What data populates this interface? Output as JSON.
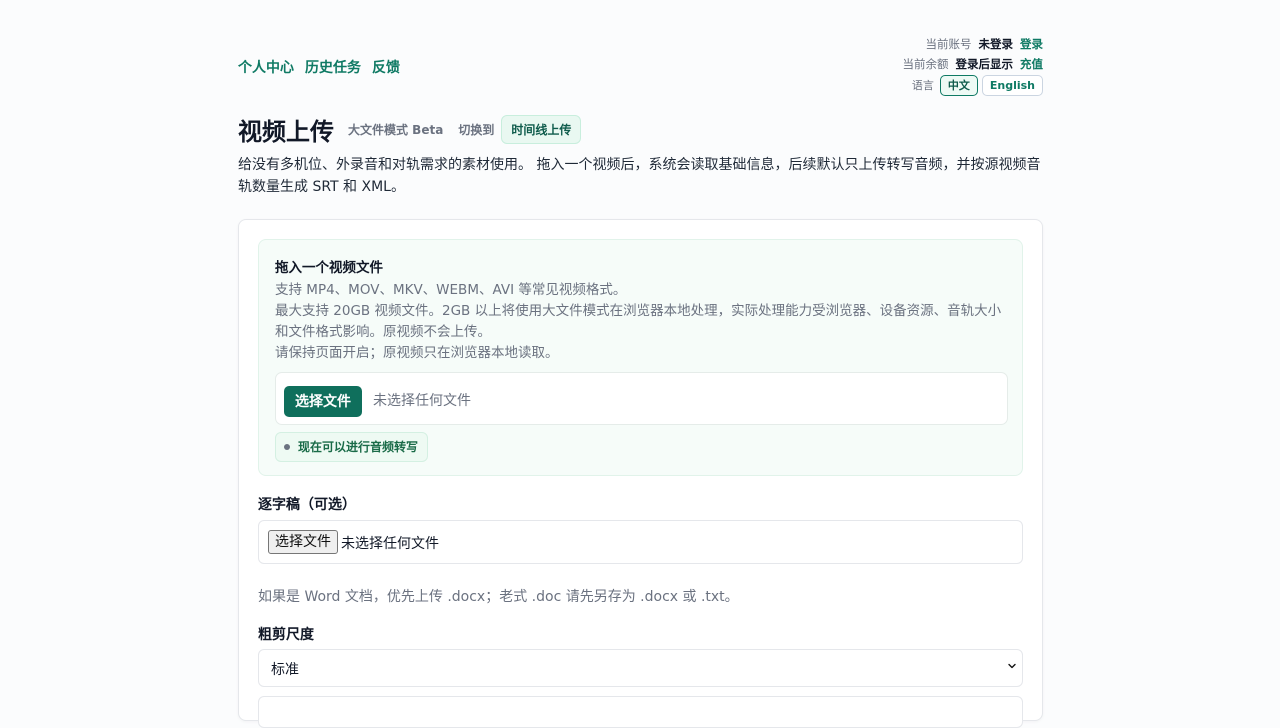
{
  "nav": {
    "items": [
      "个人中心",
      "历史任务",
      "反馈"
    ]
  },
  "account": {
    "account_label": "当前账号",
    "account_value": "未登录",
    "login_link": "登录",
    "balance_label": "当前余额",
    "balance_value": "登录后显示",
    "recharge_link": "充值",
    "language_label": "语言",
    "language_active": "中文",
    "language_other": "English"
  },
  "header": {
    "title": "视频上传",
    "mode": "大文件模式 Beta",
    "switch_label": "切换到",
    "switch_button": "时间线上传"
  },
  "intro": "给没有多机位、外录音和对轨需求的素材使用。 拖入一个视频后，系统会读取基础信息，后续默认只上传转写音频，并按源视频音轨数量生成 SRT 和 XML。",
  "dropzone": {
    "title": "拖入一个视频文件",
    "lines": [
      "支持 MP4、MOV、MKV、WEBM、AVI 等常见视频格式。",
      "最大支持 20GB 视频文件。2GB 以上将使用大文件模式在浏览器本地处理，实际处理能力受浏览器、设备资源、音轨大小和文件格式影响。原视频不会上传。",
      "请保持页面开启；原视频只在浏览器本地读取。"
    ],
    "choose_button": "选择文件",
    "no_file": "未选择任何文件",
    "status": "现在可以进行音频转写"
  },
  "transcript": {
    "label": "逐字稿（可选）",
    "choose_button": "选择文件",
    "no_file": "未选择任何文件",
    "help": "如果是 Word 文档，优先上传 .docx；老式 .doc 请先另存为 .docx 或 .txt。"
  },
  "cut": {
    "label": "粗剪尺度",
    "selected": "标准"
  },
  "colors": {
    "accent": "#0f7a64",
    "primary_button": "#0f6f5c"
  }
}
